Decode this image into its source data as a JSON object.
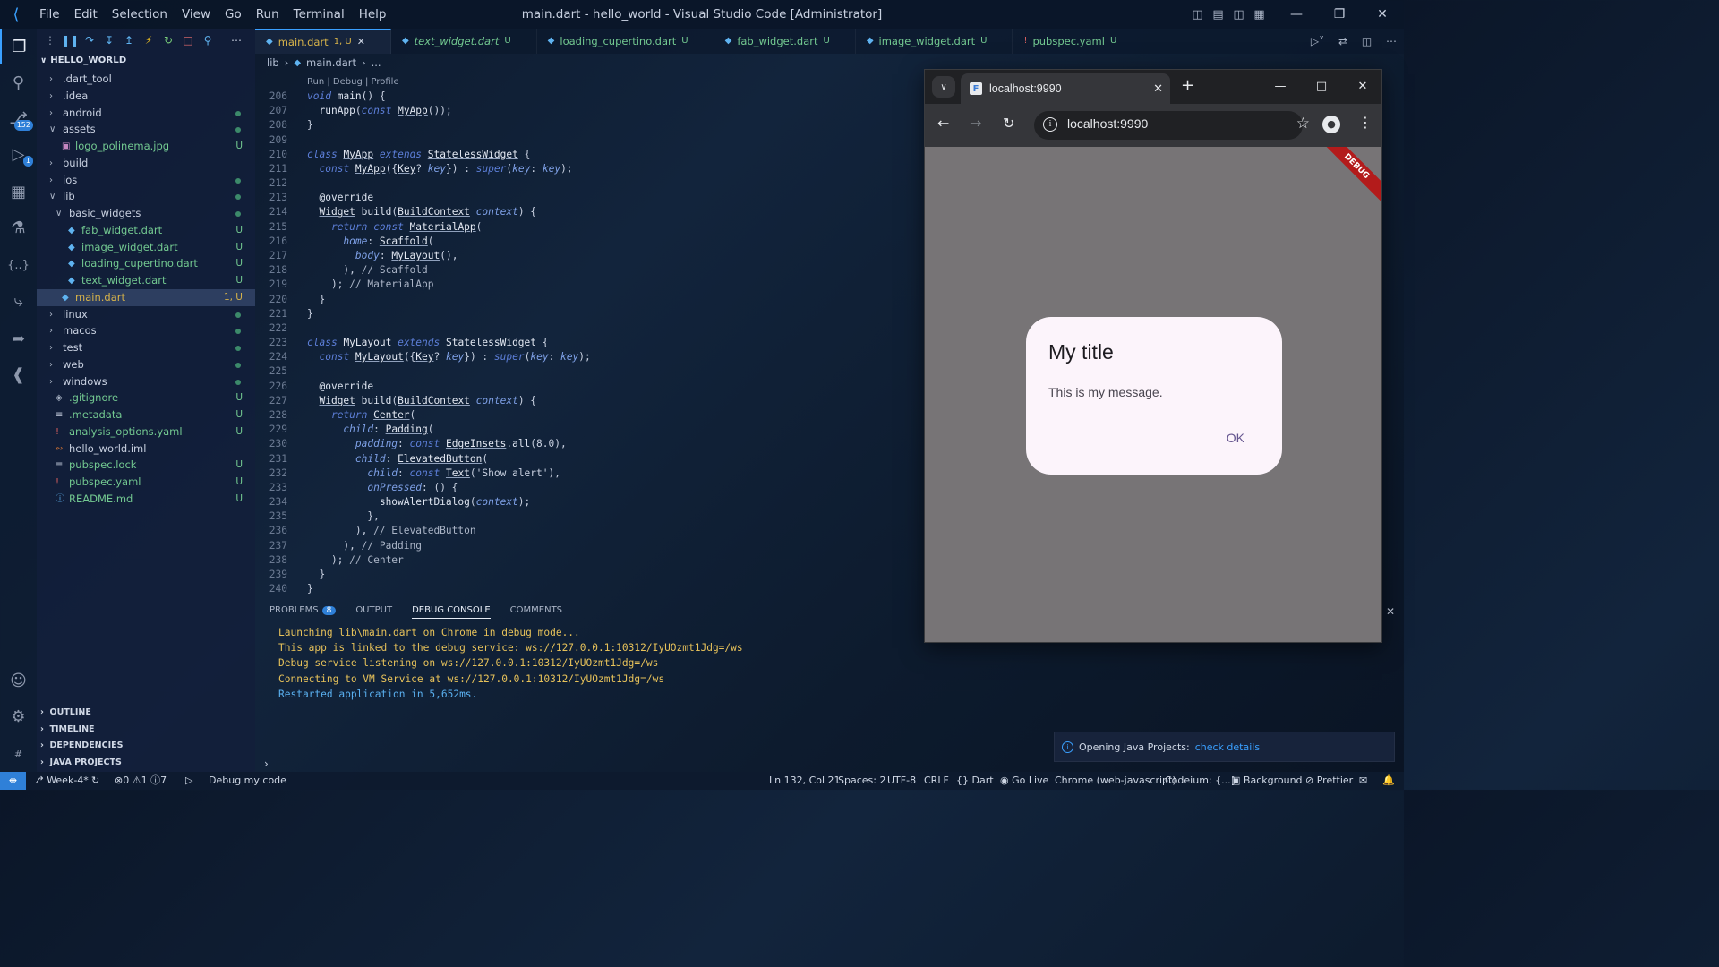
{
  "titlebar": {
    "menu": [
      "File",
      "Edit",
      "Selection",
      "View",
      "Go",
      "Run",
      "Terminal",
      "Help"
    ],
    "window_title": "main.dart - hello_world - Visual Studio Code [Administrator]"
  },
  "activity": {
    "scm_badge": "152",
    "debug_badge": "1"
  },
  "explorer": {
    "root": "HELLO_WORLD",
    "items": [
      {
        "label": ".dart_tool",
        "type": "folder",
        "open": false,
        "indent": 0,
        "status": ""
      },
      {
        "label": ".idea",
        "type": "folder",
        "open": false,
        "indent": 0,
        "status": ""
      },
      {
        "label": "android",
        "type": "folder",
        "open": false,
        "indent": 0,
        "status": "dot"
      },
      {
        "label": "assets",
        "type": "folder",
        "open": true,
        "indent": 0,
        "status": "dot"
      },
      {
        "label": "logo_polinema.jpg",
        "type": "image",
        "open": false,
        "indent": 1,
        "status": "U"
      },
      {
        "label": "build",
        "type": "folder",
        "open": false,
        "indent": 0,
        "status": ""
      },
      {
        "label": "ios",
        "type": "folder",
        "open": false,
        "indent": 0,
        "status": "dot"
      },
      {
        "label": "lib",
        "type": "folder",
        "open": true,
        "indent": 0,
        "status": "dot"
      },
      {
        "label": "basic_widgets",
        "type": "folder",
        "open": true,
        "indent": 1,
        "status": "dot"
      },
      {
        "label": "fab_widget.dart",
        "type": "dart",
        "open": false,
        "indent": 2,
        "status": "U"
      },
      {
        "label": "image_widget.dart",
        "type": "dart",
        "open": false,
        "indent": 2,
        "status": "U"
      },
      {
        "label": "loading_cupertino.dart",
        "type": "dart",
        "open": false,
        "indent": 2,
        "status": "U"
      },
      {
        "label": "text_widget.dart",
        "type": "dart",
        "open": false,
        "indent": 2,
        "status": "U"
      },
      {
        "label": "main.dart",
        "type": "dart",
        "open": false,
        "indent": 1,
        "status": "1, U",
        "selected": true
      },
      {
        "label": "linux",
        "type": "folder",
        "open": false,
        "indent": 0,
        "status": "dot"
      },
      {
        "label": "macos",
        "type": "folder",
        "open": false,
        "indent": 0,
        "status": "dot"
      },
      {
        "label": "test",
        "type": "folder",
        "open": false,
        "indent": 0,
        "status": "dot"
      },
      {
        "label": "web",
        "type": "folder",
        "open": false,
        "indent": 0,
        "status": "dot"
      },
      {
        "label": "windows",
        "type": "folder",
        "open": false,
        "indent": 0,
        "status": "dot"
      },
      {
        "label": ".gitignore",
        "type": "git",
        "open": false,
        "indent": 0,
        "status": "U"
      },
      {
        "label": ".metadata",
        "type": "text",
        "open": false,
        "indent": 0,
        "status": "U"
      },
      {
        "label": "analysis_options.yaml",
        "type": "yaml",
        "open": false,
        "indent": 0,
        "status": "U"
      },
      {
        "label": "hello_world.iml",
        "type": "xml",
        "open": false,
        "indent": 0,
        "status": ""
      },
      {
        "label": "pubspec.lock",
        "type": "text",
        "open": false,
        "indent": 0,
        "status": "U"
      },
      {
        "label": "pubspec.yaml",
        "type": "yaml",
        "open": false,
        "indent": 0,
        "status": "U"
      },
      {
        "label": "README.md",
        "type": "info",
        "open": false,
        "indent": 0,
        "status": "U"
      }
    ],
    "sections": [
      "OUTLINE",
      "TIMELINE",
      "DEPENDENCIES",
      "JAVA PROJECTS"
    ]
  },
  "tabs": [
    {
      "name": "main.dart",
      "status": "1, U",
      "active": true,
      "italic": false,
      "icon": "dart"
    },
    {
      "name": "text_widget.dart",
      "status": "U",
      "active": false,
      "italic": true,
      "icon": "dart"
    },
    {
      "name": "loading_cupertino.dart",
      "status": "U",
      "active": false,
      "italic": false,
      "icon": "dart"
    },
    {
      "name": "fab_widget.dart",
      "status": "U",
      "active": false,
      "italic": false,
      "icon": "dart"
    },
    {
      "name": "image_widget.dart",
      "status": "U",
      "active": false,
      "italic": false,
      "icon": "dart"
    },
    {
      "name": "pubspec.yaml",
      "status": "U",
      "active": false,
      "italic": false,
      "icon": "yaml"
    }
  ],
  "breadcrumb": [
    "lib",
    "main.dart",
    "..."
  ],
  "editor": {
    "codelens": "Run | Debug | Profile",
    "lines": [
      {
        "n": "206",
        "html": "<span class='kw'>void</span> <span class='fn'>main</span>() {"
      },
      {
        "n": "207",
        "html": "  <span class='fn'>runApp</span>(<span class='kw'>const</span> <span class='ty'>MyApp</span>());"
      },
      {
        "n": "208",
        "html": "}"
      },
      {
        "n": "209",
        "html": ""
      },
      {
        "n": "210",
        "html": "<span class='kw'>class</span> <span class='ty'>MyApp</span> <span class='kw'>extends</span> <span class='ty'>StatelessWidget</span> {"
      },
      {
        "n": "211",
        "html": "  <span class='kw'>const</span> <span class='ty'>MyApp</span>({<span class='ty'>Key</span>? <span class='pm'>key</span>}) : <span class='kw'>super</span>(<span class='pm'>key</span>: <span class='pm'>key</span>);"
      },
      {
        "n": "212",
        "html": ""
      },
      {
        "n": "213",
        "html": "  <span class='an'>@override</span>"
      },
      {
        "n": "214",
        "html": "  <span class='ty'>Widget</span> <span class='fn'>build</span>(<span class='ty'>BuildContext</span> <span class='pm'>context</span>) {"
      },
      {
        "n": "215",
        "html": "    <span class='kw'>return</span> <span class='kw'>const</span> <span class='ty'>MaterialApp</span>("
      },
      {
        "n": "216",
        "html": "      <span class='pm'>home</span>: <span class='ty'>Scaffold</span>("
      },
      {
        "n": "217",
        "html": "        <span class='pm'>body</span>: <span class='ty'>MyLayout</span>(),"
      },
      {
        "n": "218",
        "html": "      ), <span class='cm'>// Scaffold</span>"
      },
      {
        "n": "219",
        "html": "    ); <span class='cm'>// MaterialApp</span>"
      },
      {
        "n": "220",
        "html": "  }"
      },
      {
        "n": "221",
        "html": "}"
      },
      {
        "n": "222",
        "html": ""
      },
      {
        "n": "223",
        "html": "<span class='kw'>class</span> <span class='ty'>MyLayout</span> <span class='kw'>extends</span> <span class='ty'>StatelessWidget</span> {"
      },
      {
        "n": "224",
        "html": "  <span class='kw'>const</span> <span class='ty'>MyLayout</span>({<span class='ty'>Key</span>? <span class='pm'>key</span>}) : <span class='kw'>super</span>(<span class='pm'>key</span>: <span class='pm'>key</span>);"
      },
      {
        "n": "225",
        "html": ""
      },
      {
        "n": "226",
        "html": "  <span class='an'>@override</span>"
      },
      {
        "n": "227",
        "html": "  <span class='ty'>Widget</span> <span class='fn'>build</span>(<span class='ty'>BuildContext</span> <span class='pm'>context</span>) {"
      },
      {
        "n": "228",
        "html": "    <span class='kw'>return</span> <span class='ty'>Center</span>("
      },
      {
        "n": "229",
        "html": "      <span class='pm'>child</span>: <span class='ty'>Padding</span>("
      },
      {
        "n": "230",
        "html": "        <span class='pm'>padding</span>: <span class='kw'>const</span> <span class='ty'>EdgeInsets</span>.<span class='fn'>all</span>(8.0),"
      },
      {
        "n": "231",
        "html": "        <span class='pm'>child</span>: <span class='ty'>ElevatedButton</span>("
      },
      {
        "n": "232",
        "html": "          <span class='pm'>child</span>: <span class='kw'>const</span> <span class='ty'>Text</span>(<span class='st'>'Show alert'</span>),"
      },
      {
        "n": "233",
        "html": "          <span class='pm'>onPressed</span>: () {"
      },
      {
        "n": "234",
        "html": "            <span class='fn'>showAlertDialog</span>(<span class='pm'>context</span>);"
      },
      {
        "n": "235",
        "html": "          },"
      },
      {
        "n": "236",
        "html": "        ), <span class='cm'>// ElevatedButton</span>"
      },
      {
        "n": "237",
        "html": "      ), <span class='cm'>// Padding</span>"
      },
      {
        "n": "238",
        "html": "    ); <span class='cm'>// Center</span>"
      },
      {
        "n": "239",
        "html": "  }"
      },
      {
        "n": "240",
        "html": "}"
      }
    ]
  },
  "panel": {
    "tabs": [
      "PROBLEMS",
      "OUTPUT",
      "DEBUG CONSOLE",
      "COMMENTS"
    ],
    "problems_count": "8",
    "active_tab": "DEBUG CONSOLE",
    "console": [
      {
        "text": "Launching lib\\main.dart on Chrome in debug mode...",
        "color": "y"
      },
      {
        "text": "This app is linked to the debug service: ws://127.0.0.1:10312/IyUOzmt1Jdg=/ws",
        "color": "y"
      },
      {
        "text": "Debug service listening on ws://127.0.0.1:10312/IyUOzmt1Jdg=/ws",
        "color": "y"
      },
      {
        "text": "Connecting to VM Service at ws://127.0.0.1:10312/IyUOzmt1Jdg=/ws",
        "color": "y"
      },
      {
        "text": "Restarted application in 5,652ms.",
        "color": "b"
      }
    ]
  },
  "browser": {
    "tab_title": "localhost:9990",
    "url": "localhost:9990",
    "debug_banner": "DEBUG",
    "dialog": {
      "title": "My title",
      "message": "This is my message.",
      "ok": "OK"
    }
  },
  "notification": {
    "text": "Opening Java Projects:",
    "link": "check details"
  },
  "statusbar": {
    "branch": "Week-4*",
    "errors": "0",
    "warnings": "1",
    "infos": "7",
    "debug": "Debug my code",
    "position": "Ln 132, Col 21",
    "spaces": "Spaces: 2",
    "encoding": "UTF-8",
    "eol": "CRLF",
    "language": "Dart",
    "golive": "Go Live",
    "device": "Chrome (web-javascript)",
    "codeium": "Codeium: {...}",
    "background": "Background",
    "prettier": "Prettier"
  },
  "colors": {
    "accent": "#3aa0ff",
    "untracked": "#73c991",
    "console_yellow": "#e7c25a",
    "console_blue": "#5ab0f0",
    "dialog_bg": "#fcf4fb",
    "dialog_button": "#65558f",
    "flutter_scrim": "#777476",
    "debug_banner": "#b31b1b"
  }
}
